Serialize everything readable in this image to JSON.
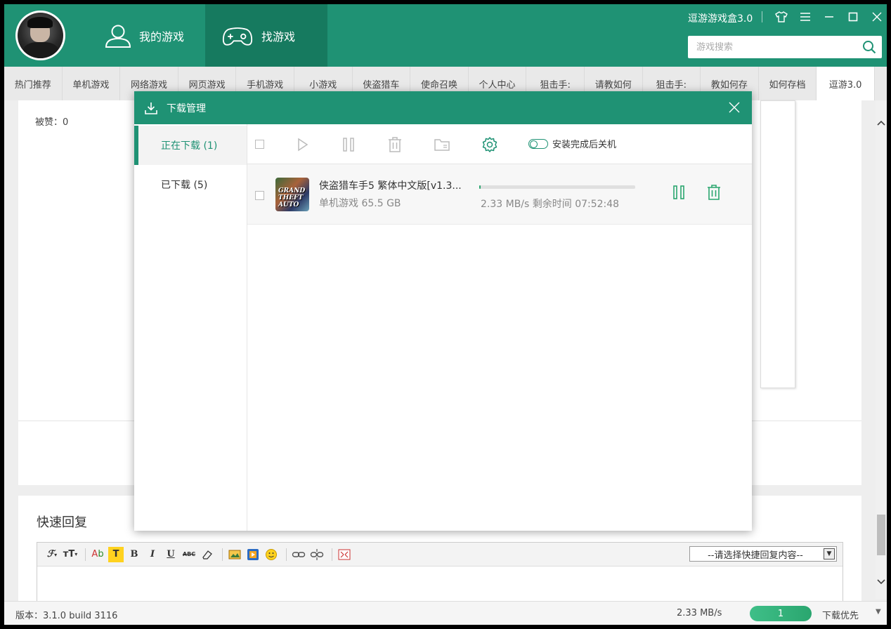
{
  "app": {
    "brand": "逗游游戏盒3.0",
    "search_placeholder": "游戏搜索"
  },
  "nav": {
    "my_games": "我的游戏",
    "find_games": "找游戏"
  },
  "categories": [
    "热门推荐",
    "单机游戏",
    "网络游戏",
    "网页游戏",
    "手机游戏",
    "小游戏",
    "侠盗猎车",
    "使命召唤",
    "个人中心",
    "狙击手:",
    "请教如何",
    "狙击手:",
    "教如何存",
    "如何存档",
    "逗游3.0"
  ],
  "page": {
    "liked": "被赞：0",
    "quick_reply_title": "快速回复",
    "quick_reply_select": "--请选择快捷回复内容--"
  },
  "dialog": {
    "title": "下载管理",
    "sidebar": {
      "downloading": "正在下载 (1)",
      "downloaded": "已下载 (5)"
    },
    "shutdown_toggle": "安装完成后关机",
    "items": [
      {
        "name": "侠盗猎车手5  繁体中文版[v1.3...",
        "category": "单机游戏",
        "size": "65.5 GB",
        "speed_text": "2.33 MB/s  剩余时间 07:52:48",
        "progress": 0.01,
        "thumb_text": "GRAND THEFT AUTO"
      }
    ]
  },
  "status": {
    "version": "版本：3.1.0 build 3116",
    "speed": "2.33 MB/s",
    "count": "1",
    "priority": "下载优先"
  },
  "colors": {
    "primary": "#1f9274",
    "primary_dark": "#167a5f",
    "accent": "#2aa66f"
  }
}
